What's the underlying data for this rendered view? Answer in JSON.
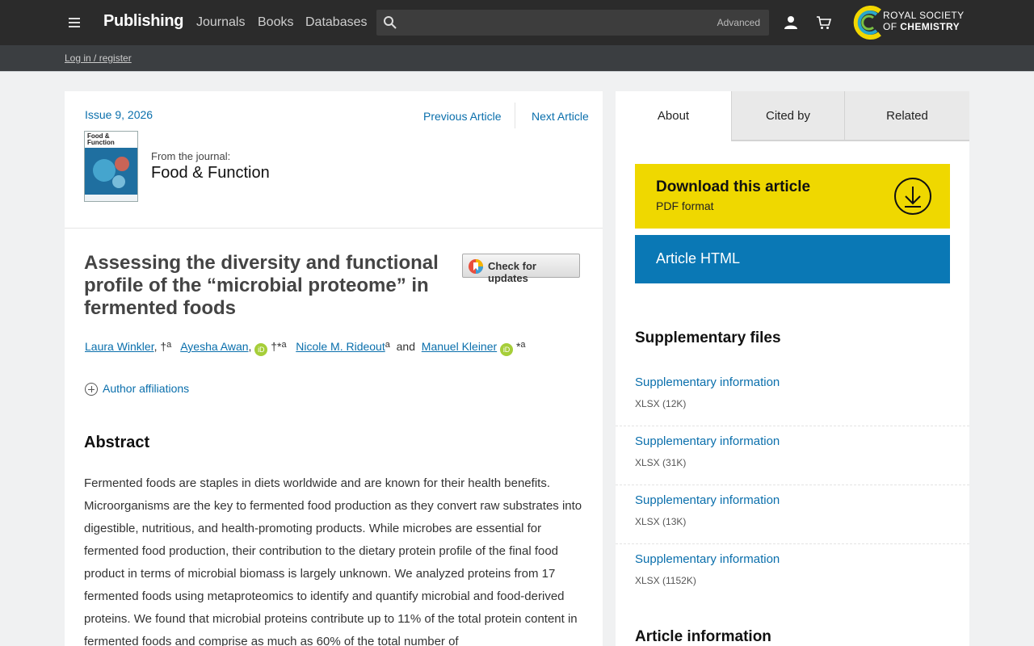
{
  "header": {
    "brand": "Publishing",
    "nav": [
      "Journals",
      "Books",
      "Databases"
    ],
    "search": {
      "placeholder": "",
      "advanced": "Advanced"
    },
    "logo": {
      "line1": "ROYAL SOCIETY",
      "line2a": "OF ",
      "line2b": "CHEMISTRY"
    }
  },
  "subbar": {
    "login": "Log in / register"
  },
  "article": {
    "issue": "Issue 9, 2026",
    "prev": "Previous Article",
    "next": "Next Article",
    "from_journal": "From the journal:",
    "journal": "Food & Function",
    "cover_title": "Food & Function",
    "title": "Assessing the diversity and functional profile of the “microbial proteome” in fermented foods",
    "check_updates": "Check for updates",
    "authors": [
      {
        "name": "Laura Winkler",
        "suffix": ", †",
        "sup": "a",
        "orcid": false
      },
      {
        "name": "Ayesha Awan",
        "suffix": ",",
        "sup": "",
        "orcid": true,
        "after": " †*",
        "after_sup": "a"
      },
      {
        "name": "Nicole M. Rideout",
        "suffix": "",
        "sup": "a",
        "orcid": false
      },
      {
        "name": "Manuel Kleiner",
        "suffix": "",
        "sup": "",
        "orcid": true,
        "after": " *",
        "after_sup": "a"
      }
    ],
    "and": "and",
    "orcid_label": "iD",
    "affiliations": "Author affiliations",
    "abstract_heading": "Abstract",
    "abstract": "Fermented foods are staples in diets worldwide and are known for their health benefits. Microorganisms are the key to fermented food production as they convert raw substrates into digestible, nutritious, and health-promoting products. While microbes are essential for fermented food production, their contribution to the dietary protein profile of the final food product in terms of microbial biomass is largely unknown. We analyzed proteins from 17 fermented foods using metaproteomics to identify and quantify microbial and food-derived proteins. We found that microbial proteins contribute up to 11% of the total protein content in fermented foods and comprise as much as 60% of the total number of"
  },
  "side": {
    "tabs": [
      "About",
      "Cited by",
      "Related"
    ],
    "download": {
      "title": "Download this article",
      "sub": "PDF format"
    },
    "html": "Article HTML",
    "supp_heading": "Supplementary files",
    "supp": [
      {
        "label": "Supplementary information",
        "meta": "XLSX (12K)"
      },
      {
        "label": "Supplementary information",
        "meta": "XLSX (31K)"
      },
      {
        "label": "Supplementary information",
        "meta": "XLSX (13K)"
      },
      {
        "label": "Supplementary information",
        "meta": "XLSX (1152K)"
      }
    ],
    "info_heading": "Article information"
  },
  "colors": {
    "link": "#0a6fac",
    "download": "#efd800",
    "html_button": "#0a78b5",
    "topbar": "#2b2b2b"
  }
}
